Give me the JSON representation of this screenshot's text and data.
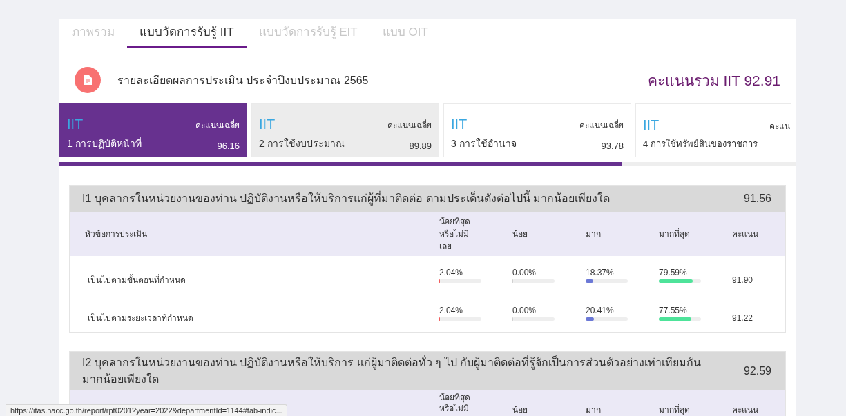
{
  "tabs": [
    {
      "label": "ภาพรวม",
      "selected": false
    },
    {
      "label": "แบบวัดการรับรู้ IIT",
      "selected": true
    },
    {
      "label": "แบบวัดการรับรู้ EIT",
      "selected": false
    },
    {
      "label": "แบบ OIT",
      "selected": false
    }
  ],
  "report": {
    "title": "รายละเอียดผลการประเมิน ประจำปีงบประมาณ 2565",
    "total": "คะแนนรวม IIT 92.91"
  },
  "indicators": [
    {
      "code": "IIT",
      "avg_label": "คะแนนเฉลี่ย",
      "name": "1 การปฏิบัติหน้าที่",
      "score": "96.16",
      "selected": true,
      "hovered": false
    },
    {
      "code": "IIT",
      "avg_label": "คะแนนเฉลี่ย",
      "name": "2 การใช้งบประมาณ",
      "score": "89.89",
      "selected": false,
      "hovered": true
    },
    {
      "code": "IIT",
      "avg_label": "คะแนนเฉลี่ย",
      "name": "3 การใช้อำนาจ",
      "score": "93.78",
      "selected": false,
      "hovered": false
    },
    {
      "code": "IIT",
      "avg_label": "คะแน",
      "name": "4 การใช้ทรัพย์สินของราชการ",
      "selected": false,
      "hovered": false
    }
  ],
  "questions": [
    {
      "title": "I1 บุคลากรในหน่วยงานของท่าน ปฏิบัติงานหรือให้บริการแก่ผู้ที่มาติดต่อ ตามประเด็นดังต่อไปนี้ มากน้อยเพียงใด",
      "score": "91.56",
      "topic_header": "หัวข้อการประเมิน",
      "columns": [
        "น้อยที่สุดหรือไม่มีเลย",
        "น้อย",
        "มาก",
        "มากที่สุด",
        "คะแนน"
      ],
      "rows": [
        {
          "topic": "เป็นไปตามขั้นตอนที่กำหนด",
          "answers": [
            {
              "percent": "2.04%",
              "level": 0.0204
            },
            {
              "percent": "0.00%",
              "level": 0
            },
            {
              "percent": "18.37%",
              "level": 0.1837
            },
            {
              "percent": "79.59%",
              "level": 0.7959
            }
          ],
          "score": "91.90"
        },
        {
          "topic": "เป็นไปตามระยะเวลาที่กำหนด",
          "answers": [
            {
              "percent": "2.04%",
              "level": 0.0204
            },
            {
              "percent": "0.00%",
              "level": 0
            },
            {
              "percent": "20.41%",
              "level": 0.2041
            },
            {
              "percent": "77.55%",
              "level": 0.7755
            }
          ],
          "score": "91.22"
        }
      ]
    },
    {
      "title": "I2 บุคลากรในหน่วยงานของท่าน ปฏิบัติงานหรือให้บริการ แก่ผู้มาติดต่อทั่ว ๆ ไป กับผู้มาติดต่อที่รู้จักเป็นการส่วนตัวอย่างเท่าเทียมกัน มากน้อยเพียงใด",
      "score": "92.59",
      "columns": [
        "น้อยที่สุดหรือไม่มี",
        "น้อย",
        "มาก",
        "มากที่สุด",
        "คะแนน"
      ]
    }
  ],
  "status_url": "https://itas.nacc.go.th/report/rpt0201?year=2022&departmentId=1144#tab-indic..."
}
